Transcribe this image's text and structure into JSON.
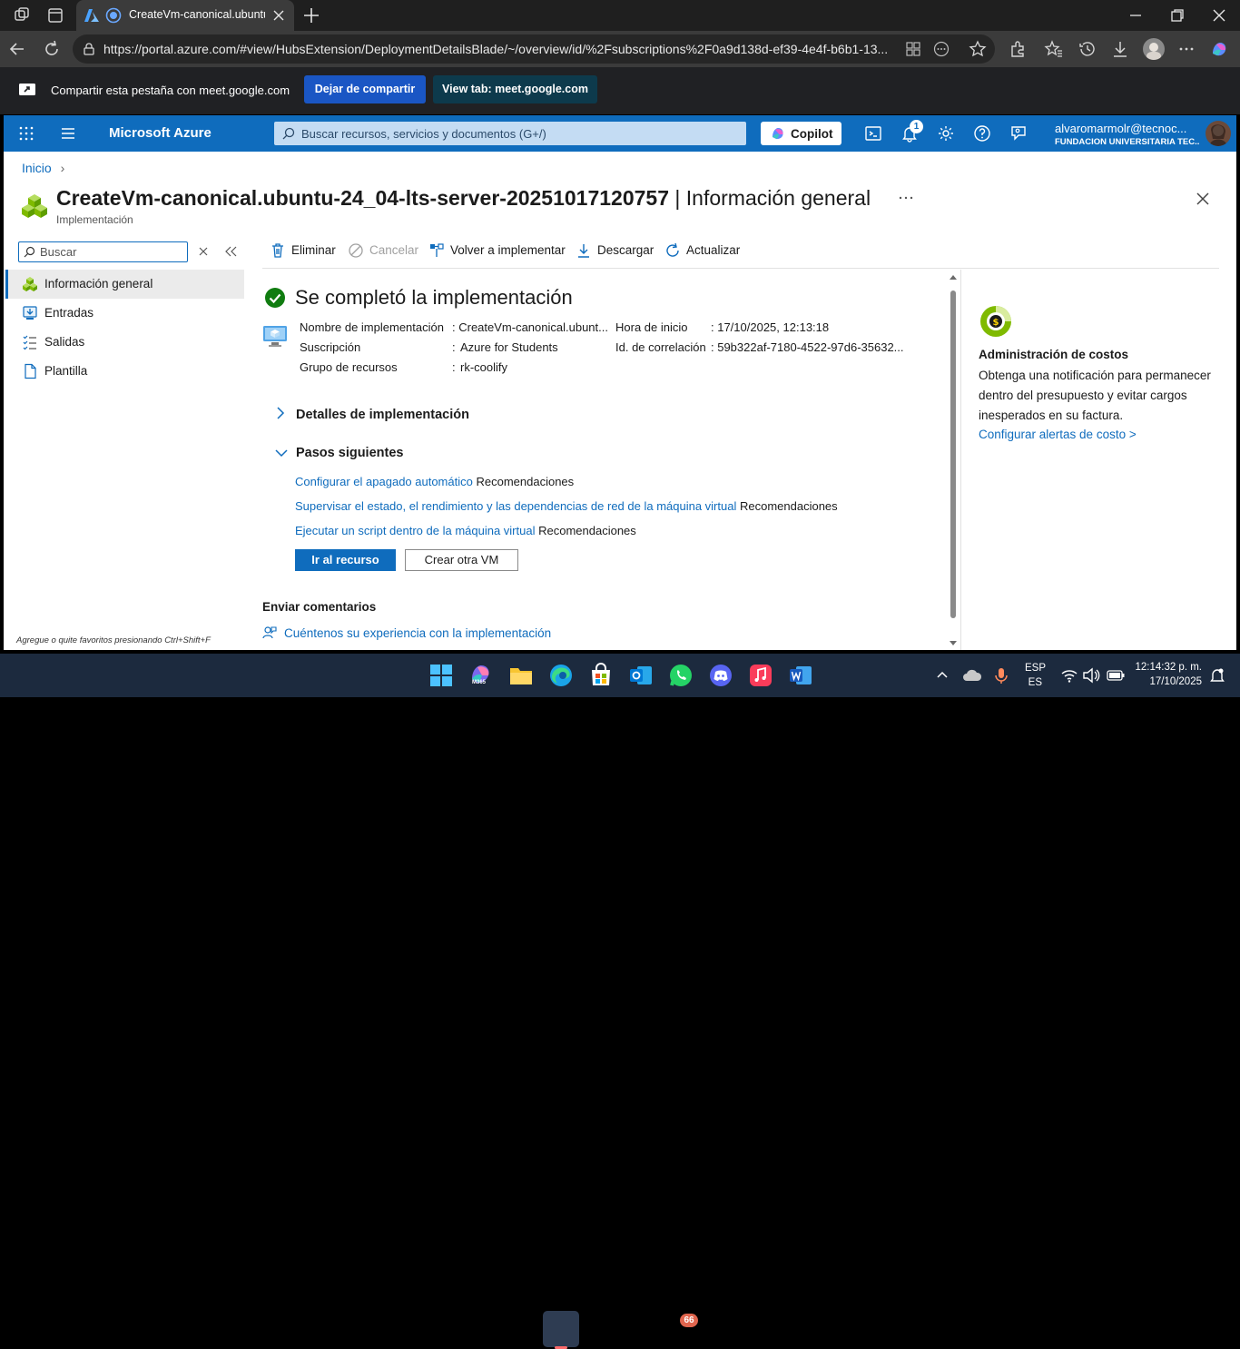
{
  "browser": {
    "tab_title": "CreateVm-canonical.ubuntu-24_04-lts-server-20251017120757",
    "url": "https://portal.azure.com/#view/HubsExtension/DeploymentDetailsBlade/~/overview/id/%2Fsubscriptions%2F0a9d138d-ef39-4e4f-b6b1-13..."
  },
  "share_bar": {
    "message": "Compartir esta pestaña con meet.google.com",
    "stop_label": "Dejar de compartir",
    "view_label": "View tab: meet.google.com"
  },
  "azure_header": {
    "brand": "Microsoft Azure",
    "search_placeholder": "Buscar recursos, servicios y documentos (G+/)",
    "copilot_label": "Copilot",
    "notifications_count": "1",
    "account_name": "alvaromarmolr@tecnoc...",
    "account_org": "FUNDACION UNIVERSITARIA TEC..."
  },
  "breadcrumb": {
    "home": "Inicio"
  },
  "page": {
    "title": "CreateVm-canonical.ubuntu-24_04-lts-server-20251017120757",
    "title_suffix": "| Información general",
    "subtitle": "Implementación"
  },
  "sidebar": {
    "search_placeholder": "Buscar",
    "items": [
      {
        "label": "Información general",
        "icon": "overview-icon"
      },
      {
        "label": "Entradas",
        "icon": "inputs-icon"
      },
      {
        "label": "Salidas",
        "icon": "outputs-icon"
      },
      {
        "label": "Plantilla",
        "icon": "template-icon"
      }
    ],
    "hint": "Agregue o quite favoritos presionando Ctrl+Shift+F"
  },
  "toolbar": {
    "delete": "Eliminar",
    "cancel": "Cancelar",
    "redeploy": "Volver a implementar",
    "download": "Descargar",
    "refresh": "Actualizar"
  },
  "deployment": {
    "status": "Se completó la implementación",
    "name_label": "Nombre de implementación",
    "name_value": ": CreateVm-canonical.ubunt...",
    "subscription_label": "Suscripción",
    "subscription_value": "Azure for Students",
    "rg_label": "Grupo de recursos",
    "rg_value": "rk-coolify",
    "start_label": "Hora de inicio",
    "start_value": ": 17/10/2025, 12:13:18",
    "corr_label": "Id. de correlación",
    "corr_value": ": 59b322af-7180-4522-97d6-35632...",
    "colon": ":"
  },
  "details_section": "Detalles de implementación",
  "next_steps": {
    "title": "Pasos siguientes",
    "recommendation": "Recomendaciones",
    "items": [
      "Configurar el apagado automático",
      "Supervisar el estado, el rendimiento y las dependencias de red de la máquina virtual",
      "Ejecutar un script dentro de la máquina virtual"
    ],
    "go_to_resource": "Ir al recurso",
    "create_another": "Crear otra VM"
  },
  "feedback": {
    "title": "Enviar comentarios",
    "link": "Cuéntenos su experiencia con la implementación"
  },
  "cost_panel": {
    "title": "Administración de costos",
    "description": "Obtenga una notificación para permanecer dentro del presupuesto y evitar cargos inesperados en su factura.",
    "link": "Configurar alertas de costo >"
  },
  "taskbar": {
    "m365_label": "M365",
    "whatsapp_badge": "66",
    "lang_1": "ESP",
    "lang_2": "ES",
    "time": "12:14:32 p. m.",
    "date": "17/10/2025"
  },
  "colors": {
    "azure_blue": "#0f6cbd",
    "success_green": "#107c10",
    "share_button": "#1a56c4"
  }
}
